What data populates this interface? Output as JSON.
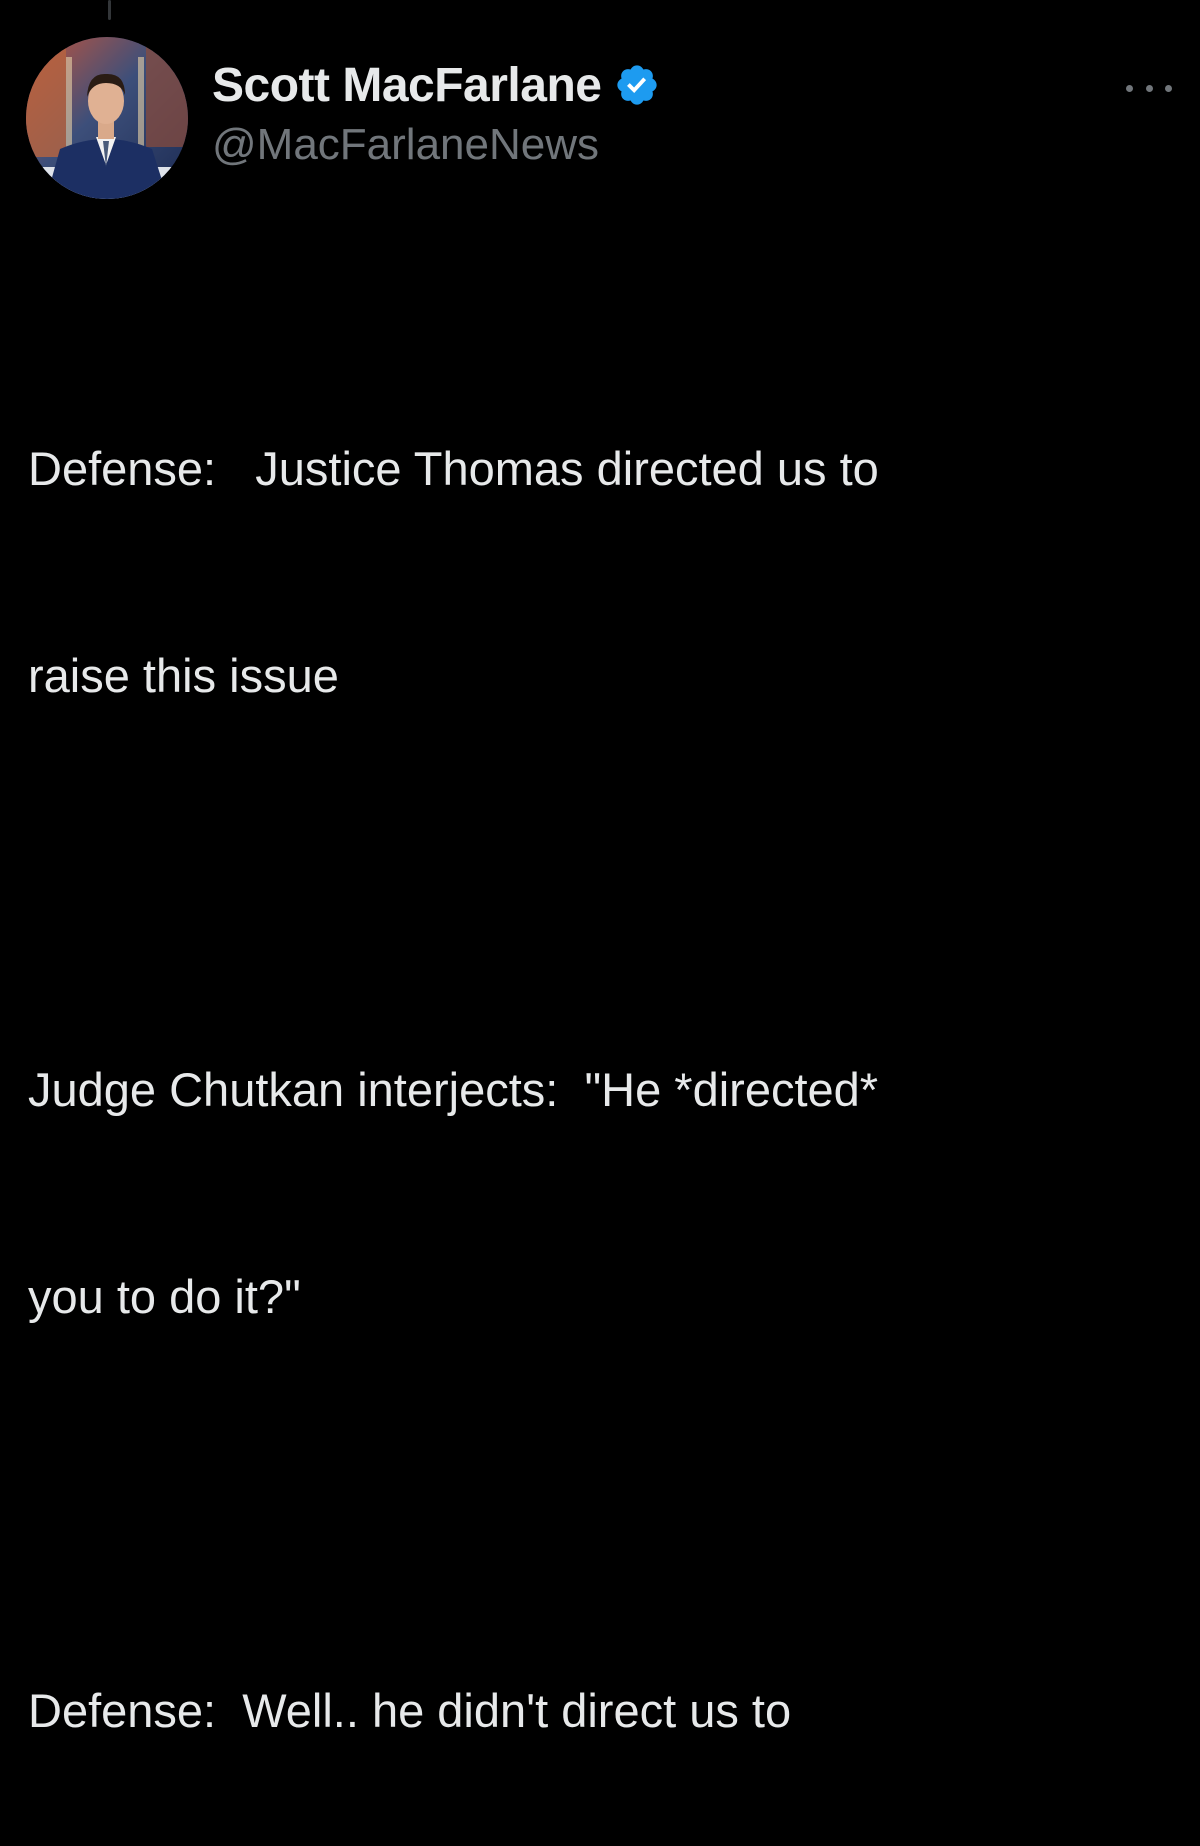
{
  "author": {
    "display_name": "Scott MacFarlane",
    "handle": "@MacFarlaneNews",
    "verified": true,
    "verified_icon": "verified-badge-icon",
    "avatar_icon": "profile-photo"
  },
  "menu": {
    "icon": "more-options-icon"
  },
  "tweet": {
    "paragraphs": [
      {
        "lines": [
          "Defense:   Justice Thomas directed us to",
          "raise this issue"
        ]
      },
      {
        "lines": [
          "Judge Chutkan interjects:  \"He *directed*",
          "you to do it?\""
        ]
      },
      {
        "lines": [
          "Defense:  Well.. he didn't direct us to"
        ]
      }
    ]
  },
  "colors": {
    "background": "#000000",
    "primary_text": "#e7e9ea",
    "secondary_text": "#71767b",
    "verified_blue": "#1d9bf0"
  }
}
